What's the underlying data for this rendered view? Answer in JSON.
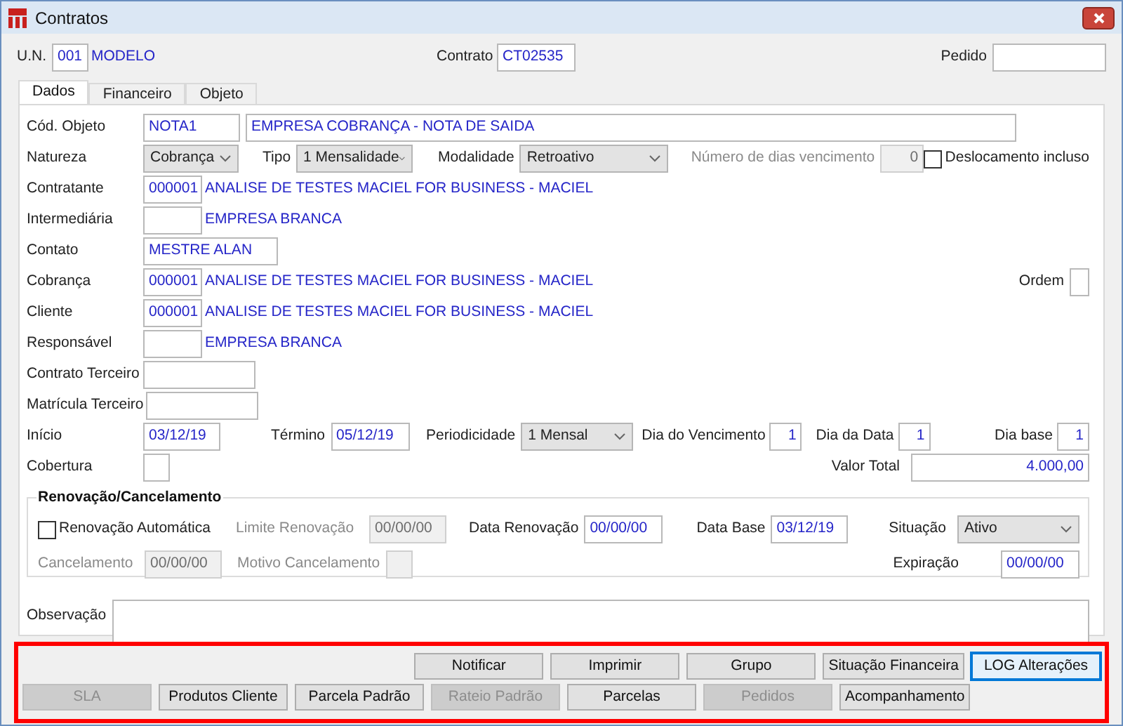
{
  "window": {
    "title": "Contratos"
  },
  "header": {
    "un": {
      "label": "U.N.",
      "value": "001",
      "name": "MODELO"
    },
    "contrato": {
      "label": "Contrato",
      "value": "CT02535"
    },
    "pedido": {
      "label": "Pedido"
    }
  },
  "tabs": [
    {
      "label": "Dados",
      "selected": true
    },
    {
      "label": "Financeiro",
      "selected": false
    },
    {
      "label": "Objeto",
      "selected": false
    }
  ],
  "dados": {
    "cod_objeto": {
      "label": "Cód. Objeto",
      "code": "NOTA1",
      "description": "EMPRESA COBRANÇA - NOTA DE SAIDA"
    },
    "natureza": {
      "label": "Natureza",
      "value": "Cobrança"
    },
    "tipo": {
      "label": "Tipo",
      "value": "1 Mensalidade"
    },
    "modalidade": {
      "label": "Modalidade",
      "value": "Retroativo"
    },
    "dias_vencimento": {
      "label": "Número de dias vencimento",
      "value": "0",
      "disabled": true
    },
    "deslocamento": {
      "label": "Deslocamento incluso",
      "checked": false
    },
    "rows": [
      {
        "kind": "lookup",
        "label": "Contratante",
        "code": "000001",
        "name": "ANALISE DE TESTES MACIEL FOR BUSINESS - MACIEL"
      },
      {
        "kind": "lookup",
        "label": "Intermediária",
        "name": "EMPRESA BRANCA"
      },
      {
        "kind": "text",
        "label": "Contato",
        "value": "MESTRE ALAN"
      },
      {
        "kind": "lookup",
        "label": "Cobrança",
        "code": "000001",
        "name": "ANALISE DE TESTES MACIEL FOR BUSINESS - MACIEL",
        "side": {
          "label": "Ordem"
        }
      },
      {
        "kind": "lookup",
        "label": "Cliente",
        "code": "000001",
        "name": "ANALISE DE TESTES MACIEL FOR BUSINESS - MACIEL"
      },
      {
        "kind": "lookup",
        "label": "Responsável",
        "name": "EMPRESA BRANCA"
      },
      {
        "kind": "text",
        "label": "Contrato Terceiro"
      },
      {
        "kind": "text",
        "label": "Matrícula Terceiro"
      }
    ],
    "inicio": {
      "label": "Início",
      "value": "03/12/19"
    },
    "termino": {
      "label": "Término",
      "value": "05/12/19"
    },
    "periodicidade": {
      "label": "Periodicidade",
      "value": "1 Mensal"
    },
    "dia_vencimento": {
      "label": "Dia do Vencimento",
      "value": "1"
    },
    "dia_data": {
      "label": "Dia da Data",
      "value": "1"
    },
    "dia_base": {
      "label": "Dia base",
      "value": "1"
    },
    "cobertura": {
      "label": "Cobertura"
    },
    "valor_total": {
      "label": "Valor Total",
      "value": "4.000,00"
    },
    "renovacao": {
      "title": "Renovação/Cancelamento",
      "automatica": {
        "label": "Renovação Automática",
        "checked": false
      },
      "limite": {
        "label": "Limite Renovação",
        "value": "00/00/00",
        "disabled": true
      },
      "data_renovacao": {
        "label": "Data Renovação",
        "value": "00/00/00"
      },
      "data_base": {
        "label": "Data Base",
        "value": "03/12/19"
      },
      "situacao": {
        "label": "Situação",
        "value": "Ativo"
      },
      "cancelamento": {
        "label": "Cancelamento",
        "value": "00/00/00",
        "disabled": true
      },
      "motivo": {
        "label": "Motivo Cancelamento",
        "disabled": true
      },
      "expiracao": {
        "label": "Expiração",
        "value": "00/00/00"
      }
    },
    "observacao": {
      "label": "Observação"
    }
  },
  "buttons": [
    [
      {
        "label": "Notificar",
        "disabled": false,
        "focused": false
      },
      {
        "label": "Imprimir",
        "disabled": false,
        "focused": false
      },
      {
        "label": "Grupo",
        "disabled": false,
        "focused": false
      },
      {
        "label": "Situação Financeira",
        "disabled": false,
        "focused": false
      },
      {
        "label": "LOG Alterações",
        "disabled": false,
        "focused": true
      }
    ],
    [
      {
        "label": "SLA",
        "disabled": true,
        "focused": false
      },
      {
        "label": "Produtos Cliente",
        "disabled": false,
        "focused": false
      },
      {
        "label": "Parcela Padrão",
        "disabled": false,
        "focused": false
      },
      {
        "label": "Rateio Padrão",
        "disabled": true,
        "focused": false
      },
      {
        "label": "Parcelas",
        "disabled": false,
        "focused": false
      },
      {
        "label": "Pedidos",
        "disabled": true,
        "focused": false
      },
      {
        "label": "Acompanhamento",
        "disabled": false,
        "focused": false
      }
    ]
  ]
}
